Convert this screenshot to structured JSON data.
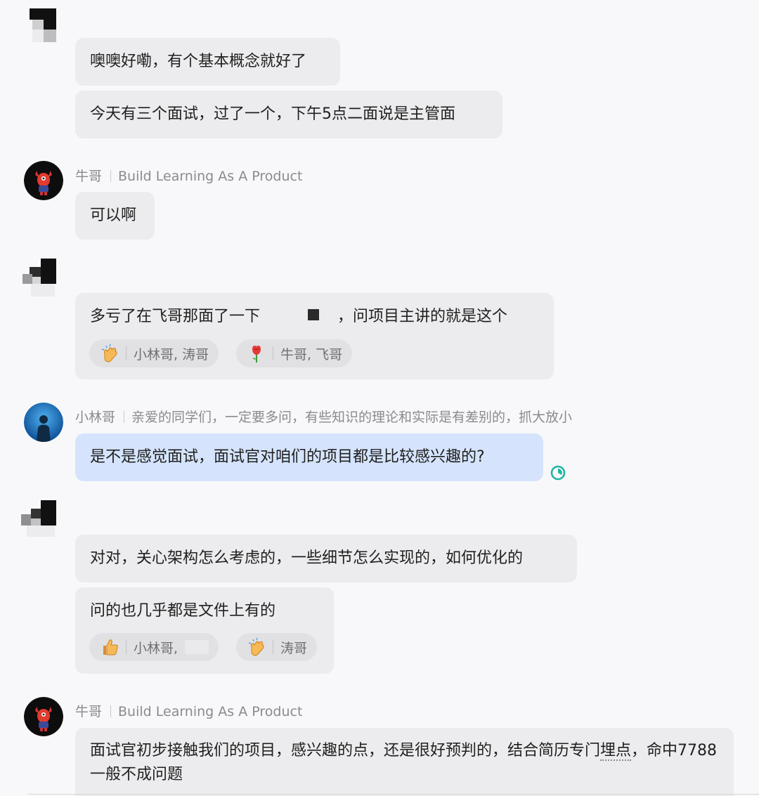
{
  "messages": {
    "m1": {
      "text": "噢噢好嘞，有个基本概念就好了"
    },
    "m2": {
      "text": "今天有三个面试，过了一个，下午5点二面说是主管面"
    },
    "niu1": {
      "name": "牛哥",
      "signature": "Build Learning As A Product",
      "text": "可以啊"
    },
    "m3": {
      "text_a": "多亏了在飞哥那面了一下",
      "text_b": "，问项目主讲的就是这个",
      "reactions": [
        {
          "emoji": "clap-emoji",
          "people": "小林哥, 涛哥"
        },
        {
          "emoji": "rose-emoji",
          "people": "牛哥, 飞哥"
        }
      ]
    },
    "lin": {
      "name": "小林哥",
      "signature": "亲爱的同学们，一定要多问，有些知识的理论和实际是有差别的，抓大放小",
      "text": "是不是感觉面试，面试官对咱们的项目都是比较感兴趣的?",
      "status_icon": "read-status-icon"
    },
    "m4": {
      "text": "对对，关心架构怎么考虑的，一些细节怎么实现的，如何优化的"
    },
    "m5": {
      "text": "问的也几乎都是文件上有的",
      "reactions": [
        {
          "emoji": "thumbs-up-emoji",
          "people": "小林哥,"
        },
        {
          "emoji": "clap-emoji",
          "people": "涛哥"
        }
      ]
    },
    "niu2": {
      "name": "牛哥",
      "signature": "Build Learning As A Product",
      "text_a": "面试官初步接触我们的项目，感兴趣的点，还是很好预判的，结合简历专门",
      "text_u": "埋点",
      "text_b": "，命中7788一般不成问题"
    }
  },
  "colors": {
    "bubble_gray": "#ececee",
    "bubble_blue": "#d5e4fc",
    "status_teal": "#1fb5a4"
  }
}
